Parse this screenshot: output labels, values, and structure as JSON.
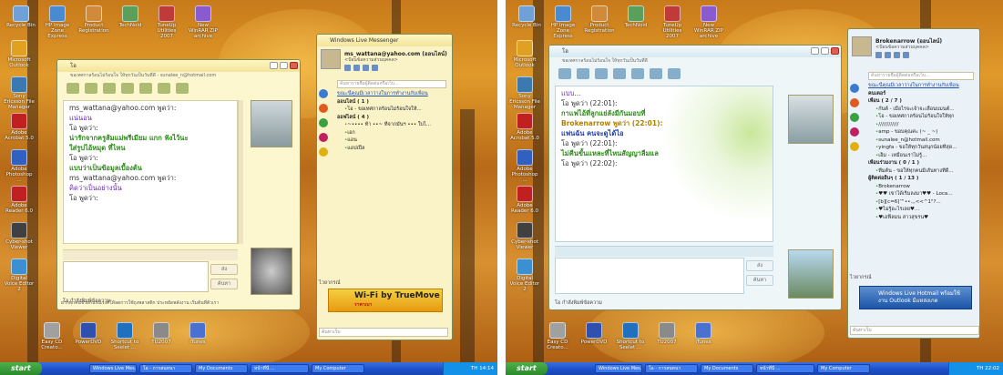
{
  "left": {
    "desktop_icons": [
      "Recycle Bin",
      "HP Image Zone Express",
      "Product Registration",
      "TechNoid",
      "TuneUp Utilities 2007",
      "New WinRAR ZIP archive",
      "Microsoft Outlook",
      "Sony Ericsson File Manager",
      "Adobe Acrobat 5.0",
      "Adobe Photoshop ...",
      "Adobe Reader 6.0",
      "Cyber-shot Viewer",
      "Digital Voice Editor 2",
      "Easy CD Creato...",
      "PowerDVD",
      "Shortcut to Seelet ...",
      "TU2007",
      "iTunes"
    ],
    "chat": {
      "title": "โอ",
      "subtitle": "ขอเทศกาลร้อนไม่ร้อนใจ ให้ทุกวันเป็นวันที่ดี - sunalee_n@hotmail.com",
      "messages": [
        {
          "text": "ms_wattana@yahoo.com พูดว่า:",
          "cls": "sender"
        },
        {
          "text": "แน่นอน",
          "cls": "purple"
        },
        {
          "text": "โอ พูดว่า:",
          "cls": "sender"
        },
        {
          "text": "",
          "cls": "sender"
        },
        {
          "text": "น่ารักจากครูส้มแม่พรีเมียม แกก ฟังไว้นะ",
          "cls": "green"
        },
        {
          "text": "",
          "cls": "sender"
        },
        {
          "text": "ใส่รูปไอ้หมุด ที่ไหน",
          "cls": "green"
        },
        {
          "text": "โอ พูดว่า:",
          "cls": "sender"
        },
        {
          "text": "แบบว่าเป็นข้อมูลเบื้องต้น",
          "cls": "green"
        },
        {
          "text": "ms_wattana@yahoo.com พูดว่า:",
          "cls": "sender"
        },
        {
          "text": "คิดว่าเป็นอย่างนั้น",
          "cls": "purple"
        },
        {
          "text": "โอ พูดว่า:",
          "cls": "sender"
        }
      ],
      "send_label": "ส่ง",
      "search_label": "ค้นหา",
      "status": "โอ กำลังพิมพ์ข้อความ",
      "hint": "ฝากทุกคนช่วยกันรณรงค์ให้ลดการใช้ถุงพลาสติก ประหยัดพลังงาน เริ่มต้นที่ตัวเรา"
    },
    "messenger": {
      "title": "Windows Live Messenger",
      "name": "ms_wattana@yahoo.com (ออนไลน์)",
      "personal_msg": "<ป้อนข้อความส่วนบุคคล>",
      "search_placeholder": "ค้นหารายชื่อผู้ติดต่อหรือเว็บ...",
      "contacts": [
        {
          "text": "ขณะนี้คุณมีเวลาว่างในการทำงานกับเพื่อน",
          "cls": "ad"
        },
        {
          "text": "ออนไลน์ ( 1 )",
          "cls": "grp"
        },
        {
          "text": "โอ - ขอเทศกาลร้อนไม่ร้อนใจให้...",
          "cls": "ppl"
        },
        {
          "text": "ออฟไลน์ ( 4 )",
          "cls": "grp"
        },
        {
          "text": "~•••• ท้า ••~ ที่จากมันฯ ••• ใบไ...",
          "cls": "ppl"
        },
        {
          "text": "เอก",
          "cls": "ppl"
        },
        {
          "text": "แอน",
          "cls": "ppl"
        },
        {
          "text": "แอปเปิ้ล",
          "cls": "ppl"
        }
      ],
      "tabs": "ไวยากรณ์",
      "ad_text": "Wi-Fi by TrueMove",
      "ad_sub": "ราคาเบา",
      "ad_replay": "Replay",
      "footer": "ค้นหาเว็บ"
    },
    "taskbar": {
      "start": "start",
      "tasks": [
        "Windows Live Mes...",
        "โอ - การสนทนา",
        "My Documents",
        "หน้าที่นี่ ...",
        "My Computer"
      ],
      "clock": "TH  14:14"
    }
  },
  "right": {
    "chat": {
      "title": "โอ",
      "subtitle": "ขอเทศกาลร้อนไม่ร้อนใจ ให้ทุกวันเป็นวันที่ดี",
      "messages": [
        {
          "text": "แบบ...",
          "cls": "purple"
        },
        {
          "text": "โอ พูดว่า (22:01):",
          "cls": "sender"
        },
        {
          "text": "กาแฟไอ้ที่ลูกแย่ลังมีกันมอบที่",
          "cls": "green"
        },
        {
          "text": "Brokenarrow พูดว่า (22:01):",
          "cls": "gold"
        },
        {
          "text": "",
          "cls": "sender"
        },
        {
          "text": "แฟนฉัน คนจะดูได้ไอ",
          "cls": "blue"
        },
        {
          "text": "โอ พูดว่า (22:01):",
          "cls": "sender"
        },
        {
          "text": "ไม่คืนขั้นแหละที่ไหนสัญญาลืมแล",
          "cls": "green"
        },
        {
          "text": "โอ พูดว่า (22:02):",
          "cls": "sender"
        }
      ],
      "send_label": "ส่ง",
      "search_label": "ค้นหา",
      "status": "โอ กำลังพิมพ์ข้อความ"
    },
    "messenger": {
      "name": "Brokenarrow (ออนไลน์)",
      "personal_msg": "<ป้อนข้อความส่วนบุคคล>",
      "search_placeholder": "ค้นหารายชื่อผู้ติดต่อหรือเว็บ...",
      "contacts": [
        {
          "text": "ขณะนี้คุณมีเวลาว่างในการทำงานกับเพื่อน",
          "cls": "ad"
        },
        {
          "text": "คนเตอร์",
          "cls": "grp"
        },
        {
          "text": "เพื่อน ( 2 / 7 )",
          "cls": "grp"
        },
        {
          "text": "กันต์ - เมื่อไรจะเจ้าจะเลือนบมนต์...",
          "cls": "ppl"
        },
        {
          "text": "โอ - ขอเทศกาลร้อนไม่ร้อนใจให้ทุก",
          "cls": "ppl"
        },
        {
          "text": "////////////",
          "cls": "ppl"
        },
        {
          "text": "amp - ขอบคุณค่ะ (~ _ ~)",
          "cls": "ppl"
        },
        {
          "text": "sunalee_n@hotmail.com",
          "cls": "ppl"
        },
        {
          "text": "yingfa - ขอให้ทุกวันสนุกน้อยที่สุด...",
          "cls": "ppl"
        },
        {
          "text": "เอ็ม - เหมือนเราไม่รู้...",
          "cls": "ppl"
        },
        {
          "text": "เพื่อนร่วมงาน ( 0 / 1 )",
          "cls": "grp"
        },
        {
          "text": "ทีมต้น - ขอให้ทุกคนมีเส้นทางที่ดี...",
          "cls": "ppl"
        },
        {
          "text": "ผู้ติดต่ออื่นๆ ( 1 / 13 )",
          "cls": "grp"
        },
        {
          "text": "Brokenarrow",
          "cls": "ppl"
        },
        {
          "text": "♥♥ เขาได้เริ่มลงมา♥♥ - Loca...",
          "cls": "ppl"
        },
        {
          "text": "[b][c=6]™••.,,<<^1\"?...",
          "cls": "ppl"
        },
        {
          "text": "♥ไม่รู้อะไรเลย♥...",
          "cls": "ppl"
        },
        {
          "text": "♥เอฟีลมน สาวสุขรน♥",
          "cls": "ppl"
        }
      ],
      "tabs": "ไวยากรณ์",
      "ad_text": "Windows Live Hotmail พร้อมใช้งาน Outlook มีแหล่งเกต",
      "ad_sub": "",
      "footer": "ค้นหาเว็บ"
    },
    "taskbar": {
      "start": "start",
      "tasks": [
        "Windows Live Mes...",
        "โอ - การสนทนา",
        "My Documents",
        "หน้าที่นี่ ...",
        "My Computer"
      ],
      "clock": "TH  22:02"
    }
  }
}
